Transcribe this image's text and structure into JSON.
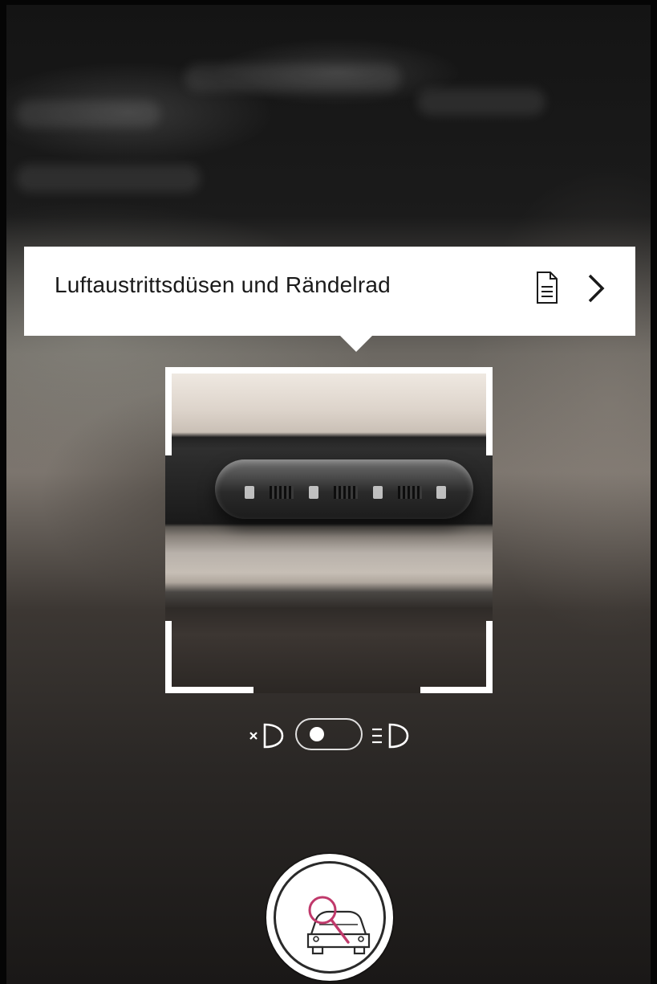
{
  "info_card": {
    "title": "Luftaustrittsdüsen und Rändelrad",
    "document_icon": "document-icon",
    "next_icon": "chevron-right-icon"
  },
  "scan_frame": {
    "subject": "air-vent-photo"
  },
  "light_toggle": {
    "off_icon": "headlight-off-icon",
    "on_icon": "headlight-on-icon",
    "state": "off"
  },
  "scan_button": {
    "icon": "car-search-icon",
    "accent_color": "#c0396b"
  }
}
